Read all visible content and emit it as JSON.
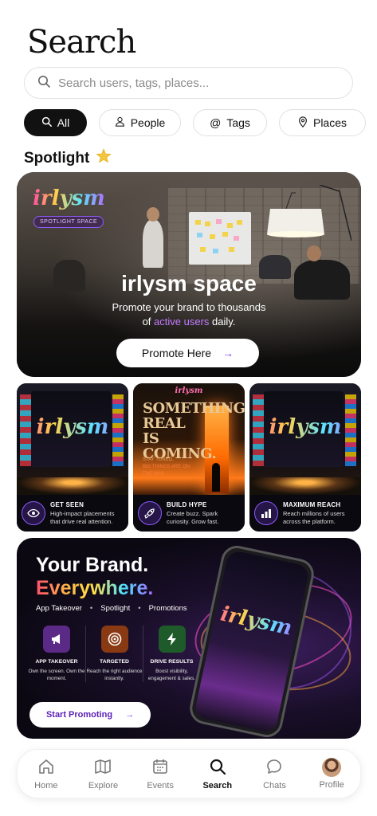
{
  "header": {
    "title": "Search"
  },
  "search": {
    "placeholder": "Search users, tags, places..."
  },
  "filters": [
    {
      "label": "All",
      "icon": "search-icon",
      "active": true
    },
    {
      "label": "People",
      "icon": "person-icon",
      "active": false
    },
    {
      "label": "Tags",
      "icon": "at-icon",
      "active": false
    },
    {
      "label": "Places",
      "icon": "pin-icon",
      "active": false
    }
  ],
  "spotlight": {
    "title": "Spotlight",
    "icon": "sparkle-star-icon",
    "hero": {
      "logo": "irlysm",
      "tag": "SPOTLIGHT SPACE",
      "heading": "irlysm space",
      "sub_line1": "Promote your brand to thousands",
      "sub_pre": "of ",
      "sub_highlight": "active users",
      "sub_post": " daily.",
      "button": "Promote Here"
    },
    "cards": [
      {
        "logo": "irlysm",
        "title": "GET SEEN",
        "desc": "High-impact placements that drive real attention.",
        "icon": "eye-icon"
      },
      {
        "logo": "irlysm",
        "poster_title": "SOMETHING REAL IS COMING.",
        "poster_sub1": "STAY TUNED.",
        "poster_sub2": "BIG THINGS ARE ON THE WAY.",
        "title": "BUILD HYPE",
        "desc": "Create buzz. Spark curiosity. Grow fast.",
        "icon": "rocket-icon"
      },
      {
        "logo": "irlysm",
        "title": "MAXIMUM REACH",
        "desc": "Reach millions of users across the platform.",
        "icon": "bar-chart-icon"
      }
    ],
    "promo": {
      "line1": "Your Brand.",
      "line2": "Everywhere.",
      "features": [
        "App Takeover",
        "Spotlight",
        "Promotions"
      ],
      "columns": [
        {
          "title": "APP TAKEOVER",
          "desc": "Own the screen. Own the moment.",
          "icon": "megaphone-icon",
          "color": "#5b2a86"
        },
        {
          "title": "TARGETED",
          "desc": "Reach the right audience instantly.",
          "icon": "target-icon",
          "color": "#8a3a12"
        },
        {
          "title": "DRIVE RESULTS",
          "desc": "Boost visibility, engagement & sales.",
          "icon": "lightning-icon",
          "color": "#1f5a2a"
        }
      ],
      "phone_logo": "irlysm",
      "button": "Start Promoting"
    }
  },
  "tabs": [
    {
      "label": "Home",
      "icon": "home-icon",
      "active": false
    },
    {
      "label": "Explore",
      "icon": "map-icon",
      "active": false
    },
    {
      "label": "Events",
      "icon": "calendar-icon",
      "active": false
    },
    {
      "label": "Search",
      "icon": "search-icon",
      "active": true
    },
    {
      "label": "Chats",
      "icon": "chat-icon",
      "active": false
    },
    {
      "label": "Profile",
      "icon": "avatar",
      "active": false
    }
  ],
  "colors": {
    "accent": "#7c3aed",
    "highlight": "#c47bff",
    "chip_active": "#111111"
  }
}
